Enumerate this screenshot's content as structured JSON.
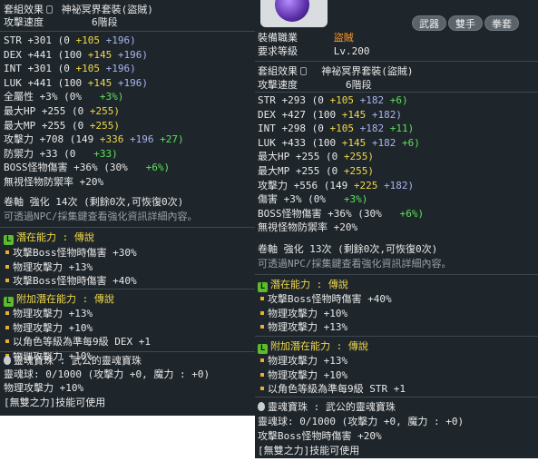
{
  "left": {
    "set_effect": {
      "label": "套組效果",
      "name": "神祕冥界套裝(盜賊)"
    },
    "attack_speed": {
      "label": "攻擊速度",
      "value": "6階段"
    },
    "stats": [
      {
        "name": "STR",
        "total": "+301",
        "base": "(0",
        "p1": "+105",
        "p2": "+196)",
        "p3": ""
      },
      {
        "name": "DEX",
        "total": "+441",
        "base": "(100",
        "p1": "+145",
        "p2": "+196)",
        "p3": ""
      },
      {
        "name": "INT",
        "total": "+301",
        "base": "(0",
        "p1": "+105",
        "p2": "+196)",
        "p3": ""
      },
      {
        "name": "LUK",
        "total": "+441",
        "base": "(100",
        "p1": "+145",
        "p2": "+196)",
        "p3": ""
      },
      {
        "name": "全屬性",
        "total": "+3%",
        "base": "(0%",
        "p1": "",
        "p2": "",
        "p3": "+3%)"
      },
      {
        "name": "最大HP",
        "total": "+255",
        "base": "(0",
        "p1": "+255)",
        "p2": "",
        "p3": ""
      },
      {
        "name": "最大MP",
        "total": "+255",
        "base": "(0",
        "p1": "+255)",
        "p2": "",
        "p3": ""
      },
      {
        "name": "攻擊力",
        "total": "+708",
        "base": "(149",
        "p1": "+336",
        "p2": "+196",
        "p3": "+27)"
      },
      {
        "name": "防禦力",
        "total": "+33",
        "base": "(0",
        "p1": "",
        "p2": "",
        "p3": "+33)"
      },
      {
        "name": "BOSS怪物傷害",
        "total": "+36%",
        "base": "(30%",
        "p1": "",
        "p2": "",
        "p3": "+6%)"
      },
      {
        "name": "無視怪物防禦率",
        "total": "+20%",
        "base": "",
        "p1": "",
        "p2": "",
        "p3": ""
      }
    ],
    "scroll": "卷軸 強化 14次 (剩餘0次,可恢復0次)",
    "hint": "可透過NPC/採集鍵查看強化資訊詳細內容。",
    "potential": {
      "title": "潛在能力 : 傳說",
      "lines": [
        "攻擊Boss怪物時傷害 +30%",
        "物理攻擊力 +13%",
        "攻擊Boss怪物時傷害 +40%"
      ]
    },
    "additional": {
      "title": "附加潛在能力 : 傳說",
      "lines": [
        "物理攻擊力 +13%",
        "物理攻擊力 +10%",
        "以角色等級為準每9級 DEX +1",
        "物理攻擊力 +10%"
      ]
    },
    "soul": {
      "title": "靈魂寶珠 : 武公的靈魂寶珠",
      "orb": "靈魂球: 0/1000 (攻擊力 +0, 魔力 : +0)",
      "effect": "物理攻擊力 +10%",
      "skill": "[無雙之力]技能可使用"
    }
  },
  "right": {
    "tags": [
      "武器",
      "雙手",
      "拳套"
    ],
    "job": {
      "label": "裝備職業",
      "value": "盜賊"
    },
    "level": {
      "label": "要求等級",
      "value": "Lv.200"
    },
    "set_effect": {
      "label": "套組效果",
      "name": "神祕冥界套裝(盜賊)"
    },
    "attack_speed": {
      "label": "攻擊速度",
      "value": "6階段"
    },
    "stats": [
      {
        "name": "STR",
        "total": "+293",
        "base": "(0",
        "p1": "+105",
        "p2": "+182",
        "p3": "+6)"
      },
      {
        "name": "DEX",
        "total": "+427",
        "base": "(100",
        "p1": "+145",
        "p2": "+182)",
        "p3": ""
      },
      {
        "name": "INT",
        "total": "+298",
        "base": "(0",
        "p1": "+105",
        "p2": "+182",
        "p3": "+11)"
      },
      {
        "name": "LUK",
        "total": "+433",
        "base": "(100",
        "p1": "+145",
        "p2": "+182",
        "p3": "+6)"
      },
      {
        "name": "最大HP",
        "total": "+255",
        "base": "(0",
        "p1": "+255)",
        "p2": "",
        "p3": ""
      },
      {
        "name": "最大MP",
        "total": "+255",
        "base": "(0",
        "p1": "+255)",
        "p2": "",
        "p3": ""
      },
      {
        "name": "攻擊力",
        "total": "+556",
        "base": "(149",
        "p1": "+225",
        "p2": "+182)",
        "p3": ""
      },
      {
        "name": "傷害",
        "total": "+3%",
        "base": "(0%",
        "p1": "",
        "p2": "",
        "p3": "+3%)"
      },
      {
        "name": "BOSS怪物傷害",
        "total": "+36%",
        "base": "(30%",
        "p1": "",
        "p2": "",
        "p3": "+6%)"
      },
      {
        "name": "無視怪物防禦率",
        "total": "+20%",
        "base": "",
        "p1": "",
        "p2": "",
        "p3": ""
      }
    ],
    "scroll": "卷軸 強化 13次 (剩餘0次,可恢復0次)",
    "hint": "可透過NPC/採集鍵查看強化資訊詳細內容。",
    "potential": {
      "title": "潛在能力 : 傳說",
      "lines": [
        "攻擊Boss怪物時傷害 +40%",
        "物理攻擊力 +10%",
        "物理攻擊力 +13%"
      ]
    },
    "additional": {
      "title": "附加潛在能力 : 傳說",
      "lines": [
        "物理攻擊力 +13%",
        "物理攻擊力 +10%",
        "以角色等級為準每9級 STR +1"
      ]
    },
    "soul": {
      "title": "靈魂寶珠 : 武公的靈魂寶珠",
      "orb": "靈魂球: 0/1000 (攻擊力 +0, 魔力 : +0)",
      "effect": "攻擊Boss怪物時傷害 +20%",
      "skill": "[無雙之力]技能可使用"
    }
  }
}
